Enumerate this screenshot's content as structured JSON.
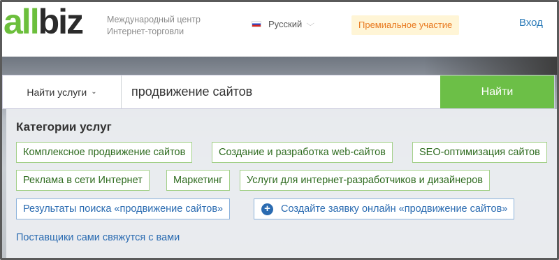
{
  "logo": {
    "part1": "all",
    "part2": "biz"
  },
  "header": {
    "tagline": "Международный центр Интернет-торговли",
    "language": "Русский",
    "premium": "Премиальное участие",
    "login": "Вход"
  },
  "search": {
    "category_label": "Найти услуги",
    "query": "продвижение сайтов",
    "button": "Найти"
  },
  "panel": {
    "title": "Категории услуг",
    "categories": [
      "Комплексное продвижение сайтов",
      "Создание и разработка web-сайтов",
      "SEO-оптимизация сайтов",
      "Реклама в сети Интернет",
      "Маркетинг",
      "Услуги для интернет-разработчиков и дизайнеров"
    ],
    "results_link": "Результаты поиска «продвижение сайтов»",
    "create_request": "Создайте заявку онлайн «продвижение сайтов»",
    "suppliers_note": "Поставщики сами свяжутся с вами"
  },
  "colors": {
    "brand_green": "#6cbf3c",
    "link_blue": "#2a6bb1",
    "premium_orange": "#e8781d"
  }
}
